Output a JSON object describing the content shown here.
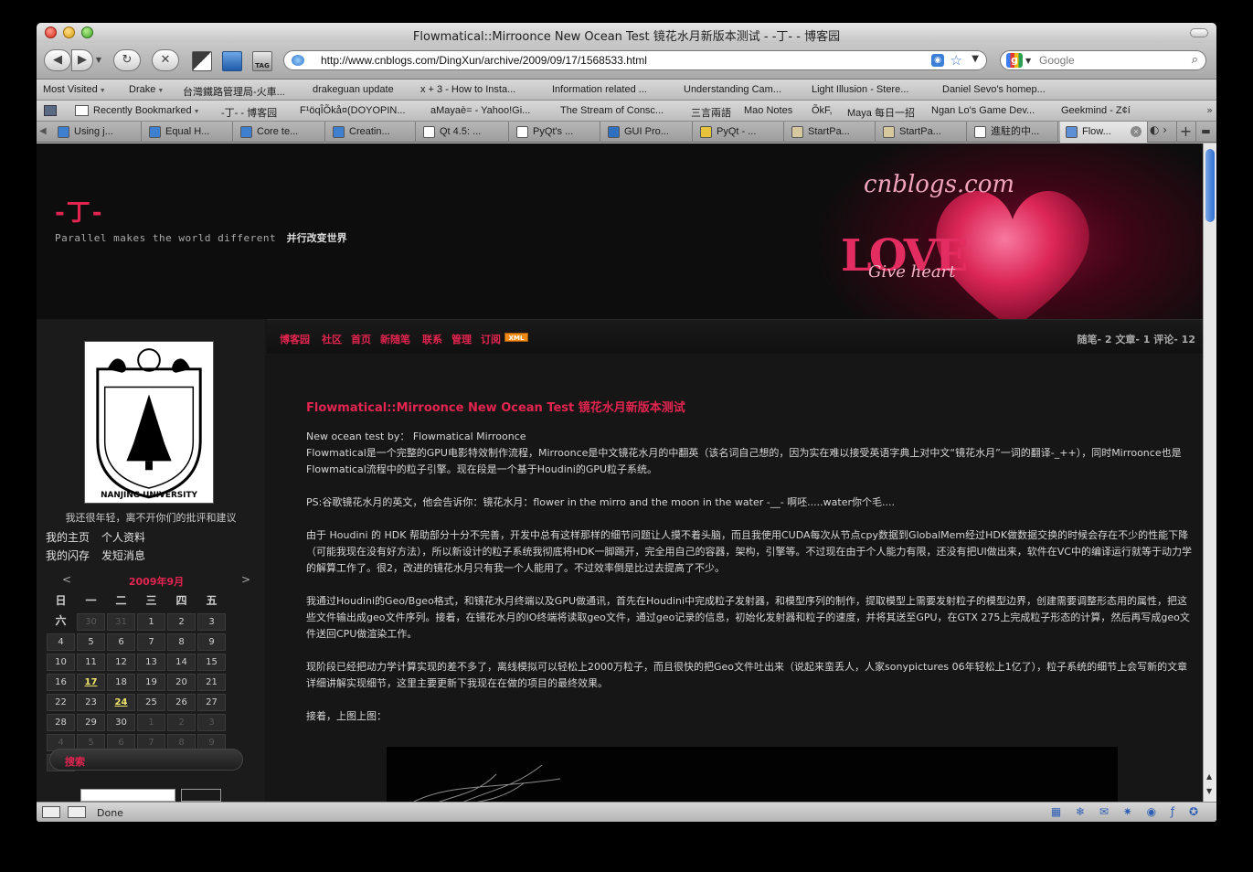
{
  "window": {
    "title": "Flowmatical::Mirroonce New Ocean Test 镜花水月新版本测试 - -丁- - 博客园"
  },
  "navbar": {
    "url": "http://www.cnblogs.com/DingXun/archive/2009/09/17/1568533.html",
    "search_placeholder": "Google",
    "tag_label": "TAG"
  },
  "bookmarks_row1": [
    {
      "label": "Most Visited",
      "dropdown": true
    },
    {
      "label": "Drake",
      "dropdown": true
    },
    {
      "label": "台灣鐵路管理局-火車..."
    },
    {
      "label": "drakeguan update"
    },
    {
      "label": "x + 3 - How to Insta..."
    },
    {
      "label": "Information related ..."
    },
    {
      "label": "Understanding Cam..."
    },
    {
      "label": "Light Illusion - Stere..."
    },
    {
      "label": "Daniel Sevo's homep..."
    }
  ],
  "bookmarks_row2": [
    {
      "label": "Recently Bookmarked",
      "dropdown": true
    },
    {
      "label": "-丁- - 博客园"
    },
    {
      "label": "F¹öqÎÕkå¤(DOYOPIN..."
    },
    {
      "label": "aMayaè= - Yahoo!Gi..."
    },
    {
      "label": "The Stream of Consc..."
    },
    {
      "label": "三言兩語"
    },
    {
      "label": "Mao Notes"
    },
    {
      "label": "ÕkF,"
    },
    {
      "label": "Maya 每日一招"
    },
    {
      "label": "Ngan Lo's Game Dev..."
    },
    {
      "label": "Geekmind - Z¢í"
    }
  ],
  "tabs": [
    {
      "label": "Using j...",
      "color": "#3f7fd0"
    },
    {
      "label": "Equal H...",
      "color": "#3f7fd0"
    },
    {
      "label": "Core te...",
      "color": "#3f7fd0"
    },
    {
      "label": "Creatin...",
      "color": "#3f7fd0"
    },
    {
      "label": "Qt 4.5: ...",
      "color": "#ffffff"
    },
    {
      "label": "PyQt's ...",
      "color": "#ffffff"
    },
    {
      "label": "GUI Pro...",
      "color": "#2f6fc0"
    },
    {
      "label": "PyQt - ...",
      "color": "#e7c33c"
    },
    {
      "label": "StartPa...",
      "color": "#d8c8a0"
    },
    {
      "label": "StartPa...",
      "color": "#d8c8a0"
    },
    {
      "label": "進駐的中...",
      "color": "#ffffff"
    },
    {
      "label": "Flow...",
      "color": "#5d8fd6",
      "active": true
    }
  ],
  "blog": {
    "title": "-丁-",
    "tagline_en": "Parallel makes the world different",
    "tagline_cn": "并行改变世界",
    "banner_text": "cnblogs.com",
    "banner_love": "LOVE",
    "banner_give": "Give heart"
  },
  "sidebar": {
    "caption": "我还很年轻，离不开你们的批评和建议",
    "links": [
      "我的主页",
      "个人资料",
      "我的闪存",
      "发短消息"
    ],
    "calendar": {
      "prev": "<",
      "next": ">",
      "month": "2009年9月",
      "weekdays": [
        "日",
        "一",
        "二",
        "三",
        "四",
        "五",
        "六"
      ],
      "weeks": [
        [
          {
            "d": "30",
            "dim": true
          },
          {
            "d": "31",
            "dim": true
          },
          {
            "d": "1"
          },
          {
            "d": "2"
          },
          {
            "d": "3"
          },
          {
            "d": "4"
          },
          {
            "d": "5"
          }
        ],
        [
          {
            "d": "6"
          },
          {
            "d": "7"
          },
          {
            "d": "8"
          },
          {
            "d": "9"
          },
          {
            "d": "10"
          },
          {
            "d": "11"
          },
          {
            "d": "12"
          }
        ],
        [
          {
            "d": "13"
          },
          {
            "d": "14"
          },
          {
            "d": "15"
          },
          {
            "d": "16"
          },
          {
            "d": "17",
            "link": true
          },
          {
            "d": "18"
          },
          {
            "d": "19"
          }
        ],
        [
          {
            "d": "20"
          },
          {
            "d": "21"
          },
          {
            "d": "22"
          },
          {
            "d": "23"
          },
          {
            "d": "24",
            "link": true
          },
          {
            "d": "25"
          },
          {
            "d": "26"
          }
        ],
        [
          {
            "d": "27"
          },
          {
            "d": "28"
          },
          {
            "d": "29"
          },
          {
            "d": "30"
          },
          {
            "d": "1",
            "dim": true
          },
          {
            "d": "2",
            "dim": true
          },
          {
            "d": "3",
            "dim": true
          }
        ],
        [
          {
            "d": "4",
            "dim": true
          },
          {
            "d": "5",
            "dim": true
          },
          {
            "d": "6",
            "dim": true
          },
          {
            "d": "7",
            "dim": true
          },
          {
            "d": "8",
            "dim": true
          },
          {
            "d": "9",
            "dim": true
          },
          {
            "d": "10",
            "dim": true
          }
        ]
      ]
    },
    "search_title": "搜索"
  },
  "nav": {
    "links": [
      "博客园",
      "社区",
      "首页",
      "新随笔",
      "联系",
      "管理",
      "订阅"
    ],
    "xml_badge": "XML",
    "stats": "随笔- 2  文章- 1  评论- 12"
  },
  "post": {
    "title": "Flowmatical::Mirroonce New Ocean Test 镜花水月新版本测试",
    "paragraphs": [
      "New ocean test by： Flowmatical Mirroonce",
      "Flowmatical是一个完整的GPU电影特效制作流程，Mirroonce是中文镜花水月的中翻英（该名词自己想的，因为实在难以接受英语字典上对中文“镜花水月”一词的翻译-_++），同时Mirroonce也是Flowmatical流程中的粒子引擎。现在段是一个基于Houdini的GPU粒子系统。",
      "PS:谷歌镜花水月的英文，他会告诉你：镜花水月：flower in the mirro and the moon in the water -__- 啊呸.....water你个毛....",
      "由于 Houdini 的 HDK 帮助部分十分不完善，开发中总有这样那样的细节问题让人摸不着头脑，而且我使用CUDA每次从节点cpy数据到GlobalMem经过HDK做数据交换的时候会存在不少的性能下降（可能我现在没有好方法），所以新设计的粒子系统我彻底将HDK一脚踢开，完全用自己的容器，架构，引擎等。不过现在由于个人能力有限，还没有把UI做出来，软件在VC中的编译运行就等于动力学的解算工作了。很2，改进的镜花水月只有我一个人能用了。不过效率倒是比过去提高了不少。",
      "我通过Houdini的Geo/Bgeo格式，和镜花水月终端以及GPU做通讯，首先在Houdini中完成粒子发射器，和模型序列的制作，提取模型上需要发射粒子的模型边界，创建需要调整形态用的属性，把这些文件输出成geo文件序列。接着，在镜花水月的IO终端将读取geo文件，通过geo记录的信息，初始化发射器和粒子的速度，并将其送至GPU，在GTX 275上完成粒子形态的计算，然后再写成geo文件送回CPU做渲染工作。",
      "现阶段已经把动力学计算实现的差不多了，离线模拟可以轻松上2000万粒子，而且很快的把Geo文件吐出来（说起来蛮丢人，人家sonypictures 06年轻松上1亿了），粒子系统的细节上会写新的文章详细讲解实现细节，这里主要更新下我现在在做的项目的最终效果。",
      "接着，上图上图："
    ]
  },
  "university": {
    "year": "1902",
    "name": "NANJING UNIVERSITY"
  },
  "status": {
    "text": "Done"
  }
}
